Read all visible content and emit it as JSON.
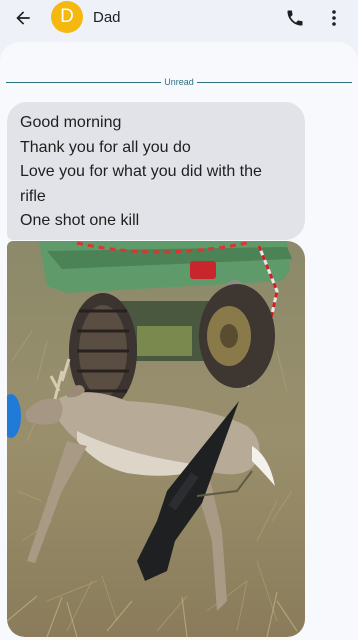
{
  "header": {
    "contact_initial": "D",
    "contact_name": "Dad",
    "avatar_color": "#f5b80f"
  },
  "thread": {
    "divider_label": "Unread",
    "message": {
      "lines": [
        "Good morning",
        "Thank you for all you do",
        "Love you for what you did with the",
        "rifle",
        "One shot one kill"
      ]
    },
    "attachment": {
      "type": "photo",
      "subject": "deer and rifle beside ATV"
    }
  },
  "icons": {
    "back": "arrow-back-icon",
    "call": "phone-icon",
    "more": "more-vert-icon"
  }
}
